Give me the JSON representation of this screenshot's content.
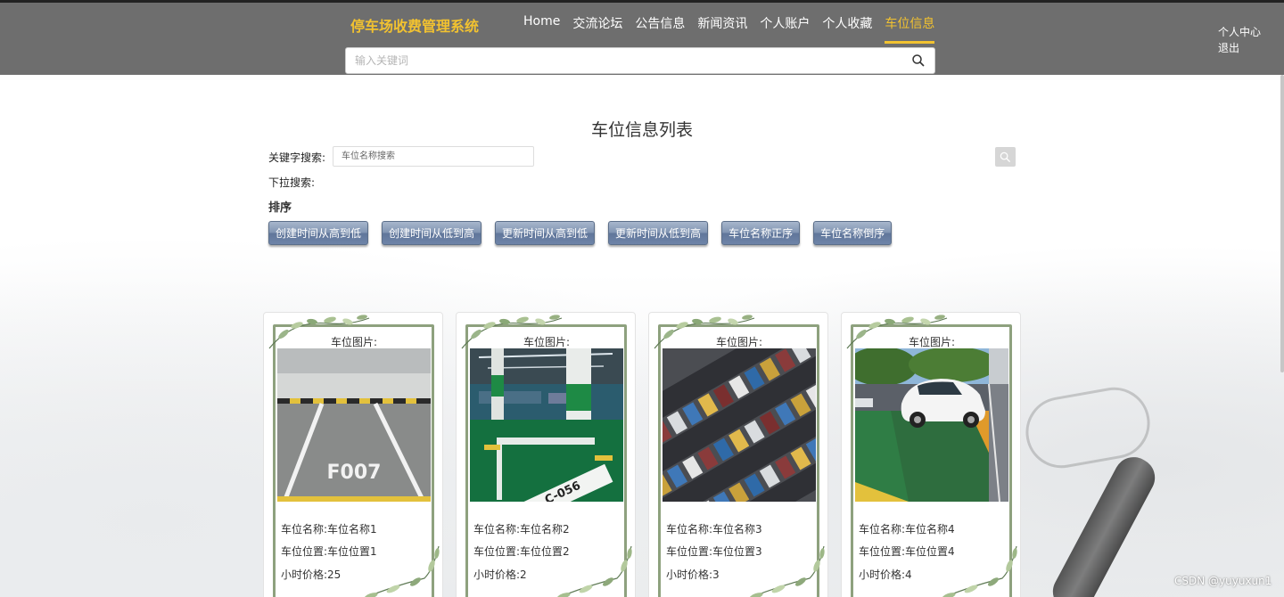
{
  "header": {
    "logo": "停车场收费管理系统",
    "nav": [
      "Home",
      "交流论坛",
      "公告信息",
      "新闻资讯",
      "个人账户",
      "个人收藏",
      "车位信息"
    ],
    "active_nav": "车位信息",
    "search_placeholder": "输入关键词",
    "user_links": [
      "个人中心",
      "退出"
    ]
  },
  "main": {
    "title": "车位信息列表",
    "keyword_label": "关键字搜索:",
    "keyword_placeholder": "车位名称搜索",
    "dropdown_label": "下拉搜索:",
    "sort_label": "排序",
    "sort_buttons": [
      "创建时间从高到低",
      "创建时间从低到高",
      "更新时间从高到低",
      "更新时间从低到高",
      "车位名称正序",
      "车位名称倒序"
    ]
  },
  "cards": [
    {
      "pic_label": "车位图片:",
      "name": "车位名称:车位名称1",
      "location": "车位位置:车位位置1",
      "price": "小时价格:25",
      "photo_text": "F007"
    },
    {
      "pic_label": "车位图片:",
      "name": "车位名称:车位名称2",
      "location": "车位位置:车位位置2",
      "price": "小时价格:2",
      "photo_text": "C-056"
    },
    {
      "pic_label": "车位图片:",
      "name": "车位名称:车位名称3",
      "location": "车位位置:车位位置3",
      "price": "小时价格:3"
    },
    {
      "pic_label": "车位图片:",
      "name": "车位名称:车位名称4",
      "location": "车位位置:车位位置4",
      "price": "小时价格:4"
    }
  ],
  "watermark": "CSDN @yuyuxun1",
  "colors": {
    "header_bg": "#6e6e6e",
    "accent": "#f2c230",
    "sort_button": "#6e84a8",
    "frame": "#8ea17e"
  },
  "icons": [
    "search-icon",
    "leaf-decoration-icon"
  ]
}
